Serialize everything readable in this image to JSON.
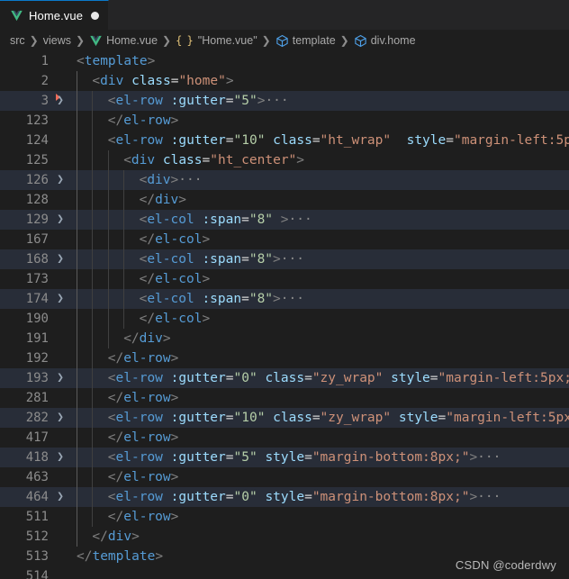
{
  "window": {
    "theme_bg": "#1e1e1e",
    "accent": "#0a7aca"
  },
  "tab": {
    "label": "Home.vue",
    "icon": "vue-icon",
    "dirty": true
  },
  "breadcrumb": {
    "items": [
      {
        "label": "src",
        "icon": null
      },
      {
        "label": "views",
        "icon": null
      },
      {
        "label": "Home.vue",
        "icon": "vue-icon"
      },
      {
        "label": "\"Home.vue\"",
        "icon": "braces-icon"
      },
      {
        "label": "template",
        "icon": "symbol-cube-icon"
      },
      {
        "label": "div.home",
        "icon": "symbol-cube-icon"
      }
    ],
    "separator": "❯"
  },
  "editor": {
    "fold_glyph": "❯",
    "lines": [
      {
        "num": "1",
        "indent": 0,
        "fold": false,
        "breakpoint": false,
        "highlight": false,
        "tokens": [
          {
            "t": "punc",
            "v": "<"
          },
          {
            "t": "tag",
            "v": "template"
          },
          {
            "t": "punc",
            "v": ">"
          }
        ]
      },
      {
        "num": "2",
        "indent": 1,
        "fold": false,
        "breakpoint": false,
        "highlight": false,
        "tokens": [
          {
            "t": "punc",
            "v": "<"
          },
          {
            "t": "tag",
            "v": "div"
          },
          {
            "t": "eq",
            "v": " "
          },
          {
            "t": "attr",
            "v": "class"
          },
          {
            "t": "eq",
            "v": "="
          },
          {
            "t": "str",
            "v": "\"home\""
          },
          {
            "t": "punc",
            "v": ">"
          }
        ]
      },
      {
        "num": "3",
        "indent": 2,
        "fold": true,
        "breakpoint": true,
        "highlight": true,
        "tokens": [
          {
            "t": "punc",
            "v": "<"
          },
          {
            "t": "tag",
            "v": "el-row"
          },
          {
            "t": "eq",
            "v": " "
          },
          {
            "t": "attr",
            "v": ":gutter"
          },
          {
            "t": "eq",
            "v": "="
          },
          {
            "t": "num",
            "v": "\"5\""
          },
          {
            "t": "punc",
            "v": ">"
          },
          {
            "t": "dots",
            "v": "···"
          }
        ]
      },
      {
        "num": "123",
        "indent": 2,
        "fold": false,
        "breakpoint": false,
        "highlight": false,
        "tokens": [
          {
            "t": "punc",
            "v": "</"
          },
          {
            "t": "tag",
            "v": "el-row"
          },
          {
            "t": "punc",
            "v": ">"
          }
        ]
      },
      {
        "num": "124",
        "indent": 2,
        "fold": false,
        "breakpoint": false,
        "highlight": false,
        "tokens": [
          {
            "t": "punc",
            "v": "<"
          },
          {
            "t": "tag",
            "v": "el-row"
          },
          {
            "t": "eq",
            "v": " "
          },
          {
            "t": "attr",
            "v": ":gutter"
          },
          {
            "t": "eq",
            "v": "="
          },
          {
            "t": "num",
            "v": "\"10\""
          },
          {
            "t": "eq",
            "v": " "
          },
          {
            "t": "attr",
            "v": "class"
          },
          {
            "t": "eq",
            "v": "="
          },
          {
            "t": "str",
            "v": "\"ht_wrap\""
          },
          {
            "t": "eq",
            "v": "  "
          },
          {
            "t": "attr",
            "v": "style"
          },
          {
            "t": "eq",
            "v": "="
          },
          {
            "t": "str",
            "v": "\"margin-left:5p"
          }
        ]
      },
      {
        "num": "125",
        "indent": 3,
        "fold": false,
        "breakpoint": false,
        "highlight": false,
        "tokens": [
          {
            "t": "punc",
            "v": "<"
          },
          {
            "t": "tag",
            "v": "div"
          },
          {
            "t": "eq",
            "v": " "
          },
          {
            "t": "attr",
            "v": "class"
          },
          {
            "t": "eq",
            "v": "="
          },
          {
            "t": "str",
            "v": "\"ht_center\""
          },
          {
            "t": "punc",
            "v": ">"
          }
        ]
      },
      {
        "num": "126",
        "indent": 4,
        "fold": true,
        "breakpoint": false,
        "highlight": true,
        "tokens": [
          {
            "t": "punc",
            "v": "<"
          },
          {
            "t": "tag",
            "v": "div"
          },
          {
            "t": "punc",
            "v": ">"
          },
          {
            "t": "dots",
            "v": "···"
          }
        ]
      },
      {
        "num": "128",
        "indent": 4,
        "fold": false,
        "breakpoint": false,
        "highlight": false,
        "tokens": [
          {
            "t": "punc",
            "v": "</"
          },
          {
            "t": "tag",
            "v": "div"
          },
          {
            "t": "punc",
            "v": ">"
          }
        ]
      },
      {
        "num": "129",
        "indent": 4,
        "fold": true,
        "breakpoint": false,
        "highlight": true,
        "tokens": [
          {
            "t": "punc",
            "v": "<"
          },
          {
            "t": "tag",
            "v": "el-col"
          },
          {
            "t": "eq",
            "v": " "
          },
          {
            "t": "attr",
            "v": ":span"
          },
          {
            "t": "eq",
            "v": "="
          },
          {
            "t": "num",
            "v": "\"8\""
          },
          {
            "t": "punc",
            "v": " >"
          },
          {
            "t": "dots",
            "v": "···"
          }
        ]
      },
      {
        "num": "167",
        "indent": 4,
        "fold": false,
        "breakpoint": false,
        "highlight": false,
        "tokens": [
          {
            "t": "punc",
            "v": "</"
          },
          {
            "t": "tag",
            "v": "el-col"
          },
          {
            "t": "punc",
            "v": ">"
          }
        ]
      },
      {
        "num": "168",
        "indent": 4,
        "fold": true,
        "breakpoint": false,
        "highlight": true,
        "tokens": [
          {
            "t": "punc",
            "v": "<"
          },
          {
            "t": "tag",
            "v": "el-col"
          },
          {
            "t": "eq",
            "v": " "
          },
          {
            "t": "attr",
            "v": ":span"
          },
          {
            "t": "eq",
            "v": "="
          },
          {
            "t": "num",
            "v": "\"8\""
          },
          {
            "t": "punc",
            "v": ">"
          },
          {
            "t": "dots",
            "v": "···"
          }
        ]
      },
      {
        "num": "173",
        "indent": 4,
        "fold": false,
        "breakpoint": false,
        "highlight": false,
        "tokens": [
          {
            "t": "punc",
            "v": "</"
          },
          {
            "t": "tag",
            "v": "el-col"
          },
          {
            "t": "punc",
            "v": ">"
          }
        ]
      },
      {
        "num": "174",
        "indent": 4,
        "fold": true,
        "breakpoint": false,
        "highlight": true,
        "tokens": [
          {
            "t": "punc",
            "v": "<"
          },
          {
            "t": "tag",
            "v": "el-col"
          },
          {
            "t": "eq",
            "v": " "
          },
          {
            "t": "attr",
            "v": ":span"
          },
          {
            "t": "eq",
            "v": "="
          },
          {
            "t": "num",
            "v": "\"8\""
          },
          {
            "t": "punc",
            "v": ">"
          },
          {
            "t": "dots",
            "v": "···"
          }
        ]
      },
      {
        "num": "190",
        "indent": 4,
        "fold": false,
        "breakpoint": false,
        "highlight": false,
        "tokens": [
          {
            "t": "punc",
            "v": "</"
          },
          {
            "t": "tag",
            "v": "el-col"
          },
          {
            "t": "punc",
            "v": ">"
          }
        ]
      },
      {
        "num": "191",
        "indent": 3,
        "fold": false,
        "breakpoint": false,
        "highlight": false,
        "tokens": [
          {
            "t": "punc",
            "v": "</"
          },
          {
            "t": "tag",
            "v": "div"
          },
          {
            "t": "punc",
            "v": ">"
          }
        ]
      },
      {
        "num": "192",
        "indent": 2,
        "fold": false,
        "breakpoint": false,
        "highlight": false,
        "tokens": [
          {
            "t": "punc",
            "v": "</"
          },
          {
            "t": "tag",
            "v": "el-row"
          },
          {
            "t": "punc",
            "v": ">"
          }
        ]
      },
      {
        "num": "193",
        "indent": 2,
        "fold": true,
        "breakpoint": false,
        "highlight": true,
        "tokens": [
          {
            "t": "punc",
            "v": "<"
          },
          {
            "t": "tag",
            "v": "el-row"
          },
          {
            "t": "eq",
            "v": " "
          },
          {
            "t": "attr",
            "v": ":gutter"
          },
          {
            "t": "eq",
            "v": "="
          },
          {
            "t": "num",
            "v": "\"0\""
          },
          {
            "t": "eq",
            "v": " "
          },
          {
            "t": "attr",
            "v": "class"
          },
          {
            "t": "eq",
            "v": "="
          },
          {
            "t": "str",
            "v": "\"zy_wrap\""
          },
          {
            "t": "eq",
            "v": " "
          },
          {
            "t": "attr",
            "v": "style"
          },
          {
            "t": "eq",
            "v": "="
          },
          {
            "t": "str",
            "v": "\"margin-left:5px;"
          }
        ]
      },
      {
        "num": "281",
        "indent": 2,
        "fold": false,
        "breakpoint": false,
        "highlight": false,
        "tokens": [
          {
            "t": "punc",
            "v": "</"
          },
          {
            "t": "tag",
            "v": "el-row"
          },
          {
            "t": "punc",
            "v": ">"
          }
        ]
      },
      {
        "num": "282",
        "indent": 2,
        "fold": true,
        "breakpoint": false,
        "highlight": true,
        "tokens": [
          {
            "t": "punc",
            "v": "<"
          },
          {
            "t": "tag",
            "v": "el-row"
          },
          {
            "t": "eq",
            "v": " "
          },
          {
            "t": "attr",
            "v": ":gutter"
          },
          {
            "t": "eq",
            "v": "="
          },
          {
            "t": "num",
            "v": "\"10\""
          },
          {
            "t": "eq",
            "v": " "
          },
          {
            "t": "attr",
            "v": "class"
          },
          {
            "t": "eq",
            "v": "="
          },
          {
            "t": "str",
            "v": "\"zy_wrap\""
          },
          {
            "t": "eq",
            "v": " "
          },
          {
            "t": "attr",
            "v": "style"
          },
          {
            "t": "eq",
            "v": "="
          },
          {
            "t": "str",
            "v": "\"margin-left:5px"
          }
        ]
      },
      {
        "num": "417",
        "indent": 2,
        "fold": false,
        "breakpoint": false,
        "highlight": false,
        "tokens": [
          {
            "t": "punc",
            "v": "</"
          },
          {
            "t": "tag",
            "v": "el-row"
          },
          {
            "t": "punc",
            "v": ">"
          }
        ]
      },
      {
        "num": "418",
        "indent": 2,
        "fold": true,
        "breakpoint": false,
        "highlight": true,
        "tokens": [
          {
            "t": "punc",
            "v": "<"
          },
          {
            "t": "tag",
            "v": "el-row"
          },
          {
            "t": "eq",
            "v": " "
          },
          {
            "t": "attr",
            "v": ":gutter"
          },
          {
            "t": "eq",
            "v": "="
          },
          {
            "t": "num",
            "v": "\"5\""
          },
          {
            "t": "eq",
            "v": " "
          },
          {
            "t": "attr",
            "v": "style"
          },
          {
            "t": "eq",
            "v": "="
          },
          {
            "t": "str",
            "v": "\"margin-bottom:8px;\""
          },
          {
            "t": "punc",
            "v": ">"
          },
          {
            "t": "dots",
            "v": "···"
          }
        ]
      },
      {
        "num": "463",
        "indent": 2,
        "fold": false,
        "breakpoint": false,
        "highlight": false,
        "tokens": [
          {
            "t": "punc",
            "v": "</"
          },
          {
            "t": "tag",
            "v": "el-row"
          },
          {
            "t": "punc",
            "v": ">"
          }
        ]
      },
      {
        "num": "464",
        "indent": 2,
        "fold": true,
        "breakpoint": false,
        "highlight": true,
        "tokens": [
          {
            "t": "punc",
            "v": "<"
          },
          {
            "t": "tag",
            "v": "el-row"
          },
          {
            "t": "eq",
            "v": " "
          },
          {
            "t": "attr",
            "v": ":gutter"
          },
          {
            "t": "eq",
            "v": "="
          },
          {
            "t": "num",
            "v": "\"0\""
          },
          {
            "t": "eq",
            "v": " "
          },
          {
            "t": "attr",
            "v": "style"
          },
          {
            "t": "eq",
            "v": "="
          },
          {
            "t": "str",
            "v": "\"margin-bottom:8px;\""
          },
          {
            "t": "punc",
            "v": ">"
          },
          {
            "t": "dots",
            "v": "···"
          }
        ]
      },
      {
        "num": "511",
        "indent": 2,
        "fold": false,
        "breakpoint": false,
        "highlight": false,
        "tokens": [
          {
            "t": "punc",
            "v": "</"
          },
          {
            "t": "tag",
            "v": "el-row"
          },
          {
            "t": "punc",
            "v": ">"
          }
        ]
      },
      {
        "num": "512",
        "indent": 1,
        "fold": false,
        "breakpoint": false,
        "highlight": false,
        "tokens": [
          {
            "t": "punc",
            "v": "</"
          },
          {
            "t": "tag",
            "v": "div"
          },
          {
            "t": "punc",
            "v": ">"
          }
        ]
      },
      {
        "num": "513",
        "indent": 0,
        "fold": false,
        "breakpoint": false,
        "highlight": false,
        "tokens": [
          {
            "t": "punc",
            "v": "</"
          },
          {
            "t": "tag",
            "v": "template"
          },
          {
            "t": "punc",
            "v": ">"
          }
        ]
      },
      {
        "num": "514",
        "indent": 0,
        "fold": false,
        "breakpoint": false,
        "highlight": false,
        "tokens": []
      }
    ]
  },
  "watermark": {
    "text": "CSDN @coderdwy"
  }
}
